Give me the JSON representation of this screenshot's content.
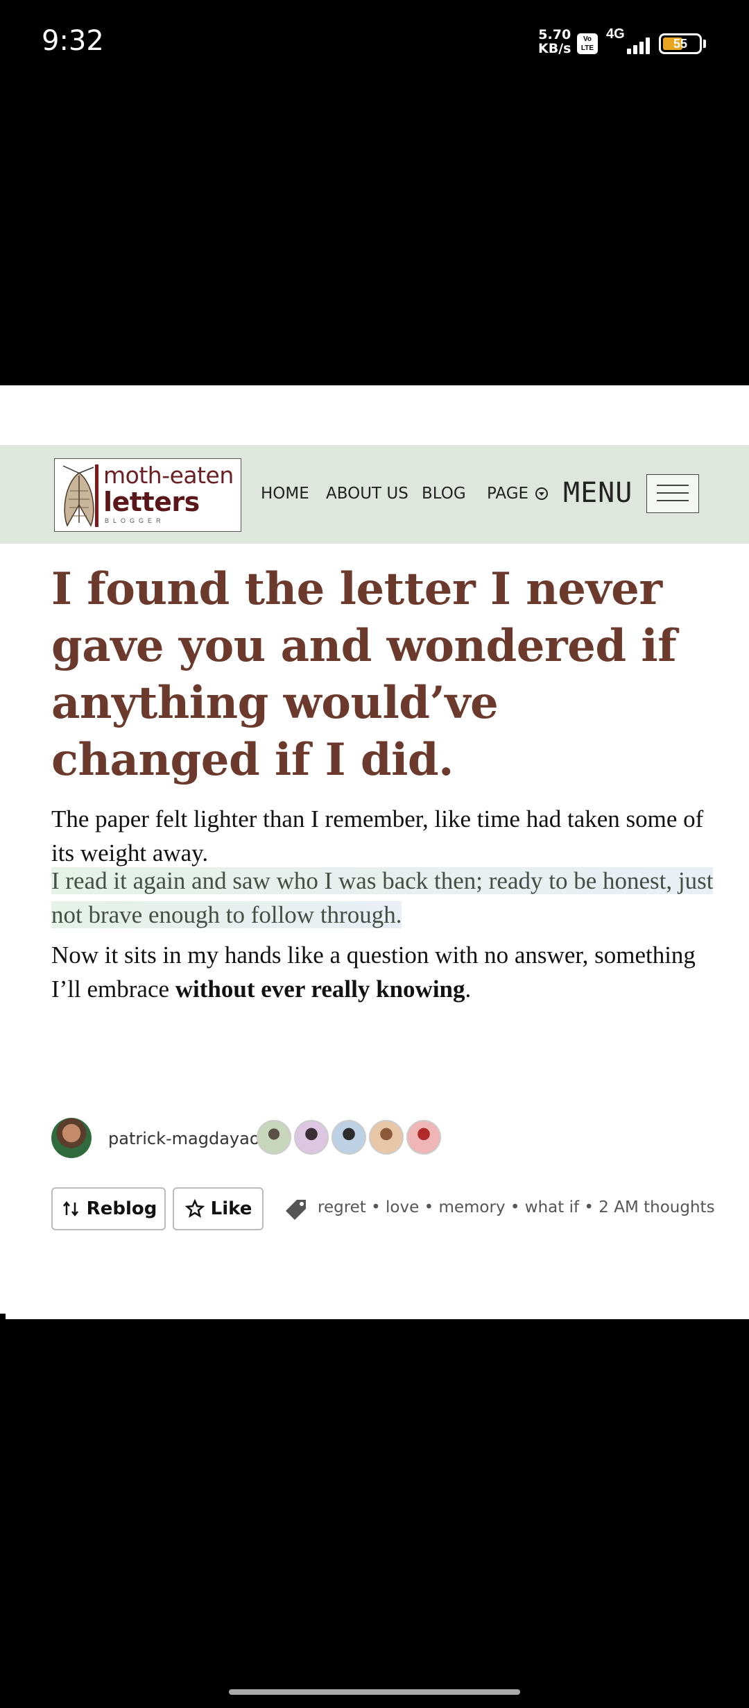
{
  "status_bar": {
    "time": "9:32",
    "net_speed_value": "5.70",
    "net_speed_unit": "KB/s",
    "volte_line1": "Vo",
    "volte_line2": "LTE",
    "network_type": "4G",
    "battery_level": "55",
    "battery_color": "#e8a521"
  },
  "header": {
    "logo_line1": "moth-eaten",
    "logo_line2": "letters",
    "logo_line3": "BLOGGER",
    "nav": [
      "HOME",
      "ABOUT US",
      "BLOG",
      "PAGE"
    ],
    "menu_label": "MENU"
  },
  "post": {
    "title": "I found the letter I never gave you and wondered if anything would’ve changed if I did.",
    "para1": "The paper felt lighter than I remember, like time had taken some of its weight away.",
    "para2": "I read it again and saw who I was back then; ready to be honest, just not brave enough to follow through.",
    "para3_start": "Now it sits in my hands like a question with no answer, something I’ll embrace ",
    "para3_bold": "without ever really knowing",
    "para3_end": "."
  },
  "author": {
    "name": "patrick-magdayao",
    "reactor_avatars": [
      "green-avatar",
      "purple-avatar",
      "blue-avatar",
      "orange-avatar",
      "red-avatar"
    ]
  },
  "actions": {
    "reblog_label": "Reblog",
    "like_label": "Like"
  },
  "tags": [
    "regret",
    "love",
    "memory",
    "what if",
    "2 AM thoughts"
  ],
  "tag_separator": " • ",
  "colors": {
    "header_bg": "#dfe6dd",
    "title": "#6b3a2c",
    "highlight": "#e6f1e8"
  }
}
